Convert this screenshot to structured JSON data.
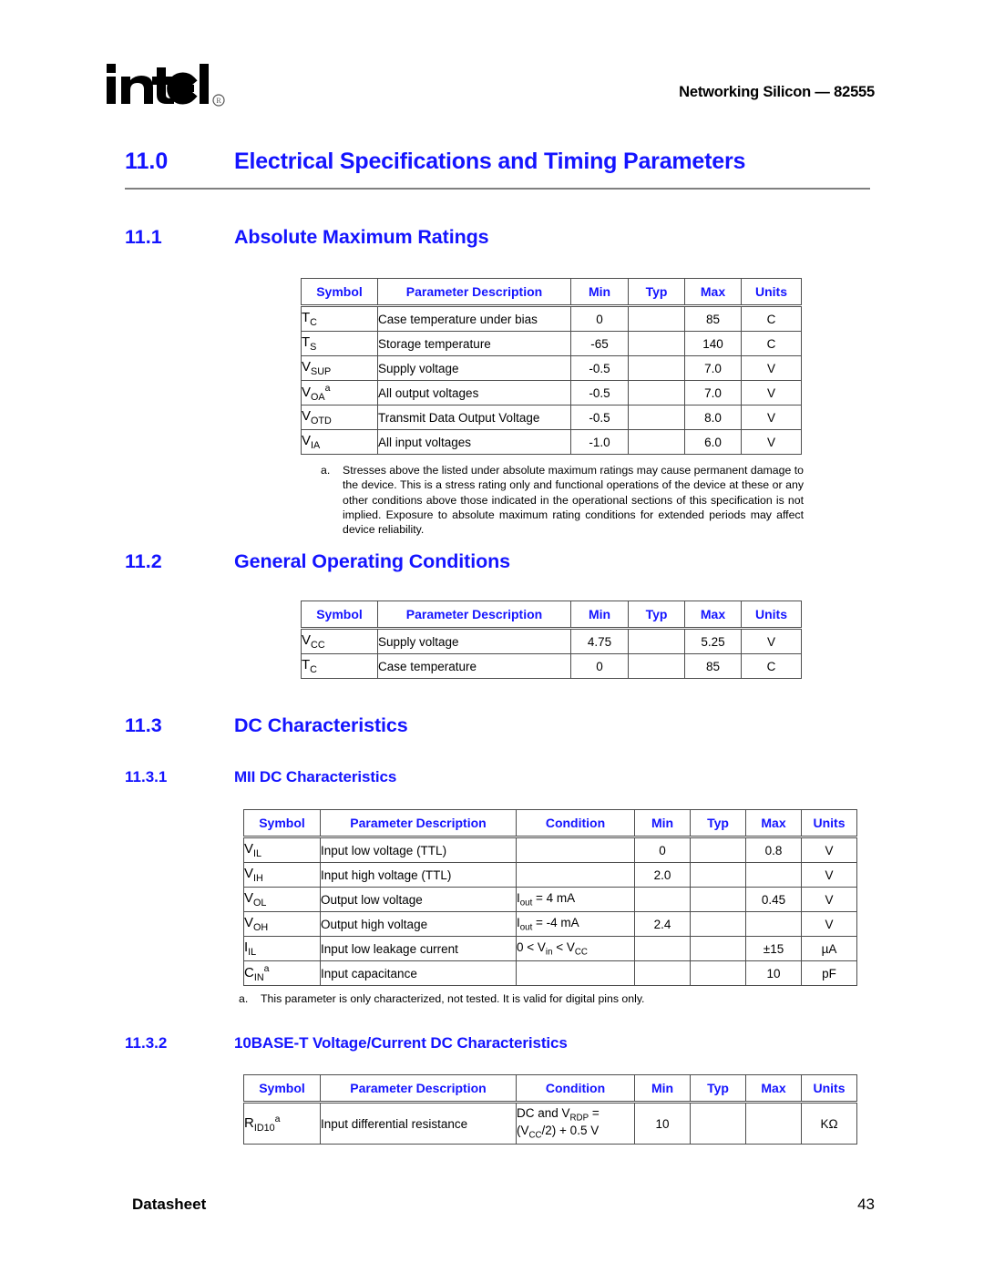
{
  "header": {
    "logo_alt": "intel",
    "right_text": "Networking Silicon — 82555"
  },
  "sections": {
    "s11_0": {
      "number": "11.0",
      "title": "Electrical Specifications and Timing Parameters"
    },
    "s11_1": {
      "number": "11.1",
      "title": "Absolute Maximum Ratings"
    },
    "s11_2": {
      "number": "11.2",
      "title": "General Operating Conditions"
    },
    "s11_3": {
      "number": "11.3",
      "title": "DC Characteristics"
    },
    "s11_3_1": {
      "number": "11.3.1",
      "title": "MII DC Characteristics"
    },
    "s11_3_2": {
      "number": "11.3.2",
      "title": "10BASE-T Voltage/Current DC Characteristics"
    }
  },
  "table_abs_max": {
    "headers": [
      "Symbol",
      "Parameter Description",
      "Min",
      "Typ",
      "Max",
      "Units"
    ],
    "rows": [
      {
        "symbol_base": "T",
        "symbol_sub": "C",
        "symbol_sup": "",
        "desc": "Case temperature under bias",
        "min": "0",
        "typ": "",
        "max": "85",
        "units": "C"
      },
      {
        "symbol_base": "T",
        "symbol_sub": "S",
        "symbol_sup": "",
        "desc": "Storage temperature",
        "min": "-65",
        "typ": "",
        "max": "140",
        "units": "C"
      },
      {
        "symbol_base": "V",
        "symbol_sub": "SUP",
        "symbol_sup": "",
        "desc": "Supply voltage",
        "min": "-0.5",
        "typ": "",
        "max": "7.0",
        "units": "V"
      },
      {
        "symbol_base": "V",
        "symbol_sub": "OA",
        "symbol_sup": "a",
        "desc": "All output voltages",
        "min": "-0.5",
        "typ": "",
        "max": "7.0",
        "units": "V"
      },
      {
        "symbol_base": "V",
        "symbol_sub": "OTD",
        "symbol_sup": "",
        "desc": "Transmit Data Output Voltage",
        "min": "-0.5",
        "typ": "",
        "max": "8.0",
        "units": "V"
      },
      {
        "symbol_base": "V",
        "symbol_sub": "IA",
        "symbol_sup": "",
        "desc": "All input voltages",
        "min": "-1.0",
        "typ": "",
        "max": "6.0",
        "units": "V"
      }
    ],
    "footnote_mark": "a.",
    "footnote_text": "Stresses above the listed under absolute maximum ratings may cause permanent damage to the device. This is a stress rating only and functional operations of the device at these or any other conditions above those indicated in the operational sections of this specification is not implied. Exposure to absolute maximum rating conditions for extended periods may affect device reliability."
  },
  "table_general_op": {
    "headers": [
      "Symbol",
      "Parameter Description",
      "Min",
      "Typ",
      "Max",
      "Units"
    ],
    "rows": [
      {
        "symbol_base": "V",
        "symbol_sub": "CC",
        "symbol_sup": "",
        "desc": "Supply voltage",
        "min": "4.75",
        "typ": "",
        "max": "5.25",
        "units": "V"
      },
      {
        "symbol_base": "T",
        "symbol_sub": "C",
        "symbol_sup": "",
        "desc": "Case temperature",
        "min": "0",
        "typ": "",
        "max": "85",
        "units": "C"
      }
    ]
  },
  "table_mii_dc": {
    "headers": [
      "Symbol",
      "Parameter Description",
      "Condition",
      "Min",
      "Typ",
      "Max",
      "Units"
    ],
    "rows": [
      {
        "symbol_base": "V",
        "symbol_sub": "IL",
        "symbol_sup": "",
        "desc": "Input low voltage (TTL)",
        "cond_html": "",
        "min": "0",
        "typ": "",
        "max": "0.8",
        "units": "V"
      },
      {
        "symbol_base": "V",
        "symbol_sub": "IH",
        "symbol_sup": "",
        "desc": "Input high voltage (TTL)",
        "cond_html": "",
        "min": "2.0",
        "typ": "",
        "max": "",
        "units": "V"
      },
      {
        "symbol_base": "V",
        "symbol_sub": "OL",
        "symbol_sup": "",
        "desc": "Output low voltage",
        "cond_html": "I<sub>out</sub> = 4 mA",
        "min": "",
        "typ": "",
        "max": "0.45",
        "units": "V"
      },
      {
        "symbol_base": "V",
        "symbol_sub": "OH",
        "symbol_sup": "",
        "desc": "Output high voltage",
        "cond_html": "I<sub>out</sub> = -4 mA",
        "min": "2.4",
        "typ": "",
        "max": "",
        "units": "V"
      },
      {
        "symbol_base": "I",
        "symbol_sub": "IL",
        "symbol_sup": "",
        "desc": "Input low leakage current",
        "cond_html": "0 &lt; V<sub>in</sub> &lt; V<sub>CC</sub>",
        "min": "",
        "typ": "",
        "max": "±15",
        "units": "µA"
      },
      {
        "symbol_base": "C",
        "symbol_sub": "IN",
        "symbol_sup": "a",
        "desc": "Input capacitance",
        "cond_html": "",
        "min": "",
        "typ": "",
        "max": "10",
        "units": "pF"
      }
    ],
    "footnote_mark": "a.",
    "footnote_text": "This parameter is only characterized, not tested. It is valid for digital pins only."
  },
  "table_10base_t": {
    "headers": [
      "Symbol",
      "Parameter Description",
      "Condition",
      "Min",
      "Typ",
      "Max",
      "Units"
    ],
    "rows": [
      {
        "symbol_base": "R",
        "symbol_sub": "ID10",
        "symbol_sup": "a",
        "desc": "Input differential resistance",
        "cond_html": "DC and V<sub>RDP</sub> =<br>(V<sub>CC</sub>/2) + 0.5 V",
        "min": "10",
        "typ": "",
        "max": "",
        "units": "KΩ"
      }
    ]
  },
  "footer": {
    "left": "Datasheet",
    "page_number": "43"
  },
  "colors": {
    "heading_blue": "#1414ff",
    "rule_gray": "#808080",
    "table_border": "#4d4d4d",
    "text_black": "#000000"
  }
}
